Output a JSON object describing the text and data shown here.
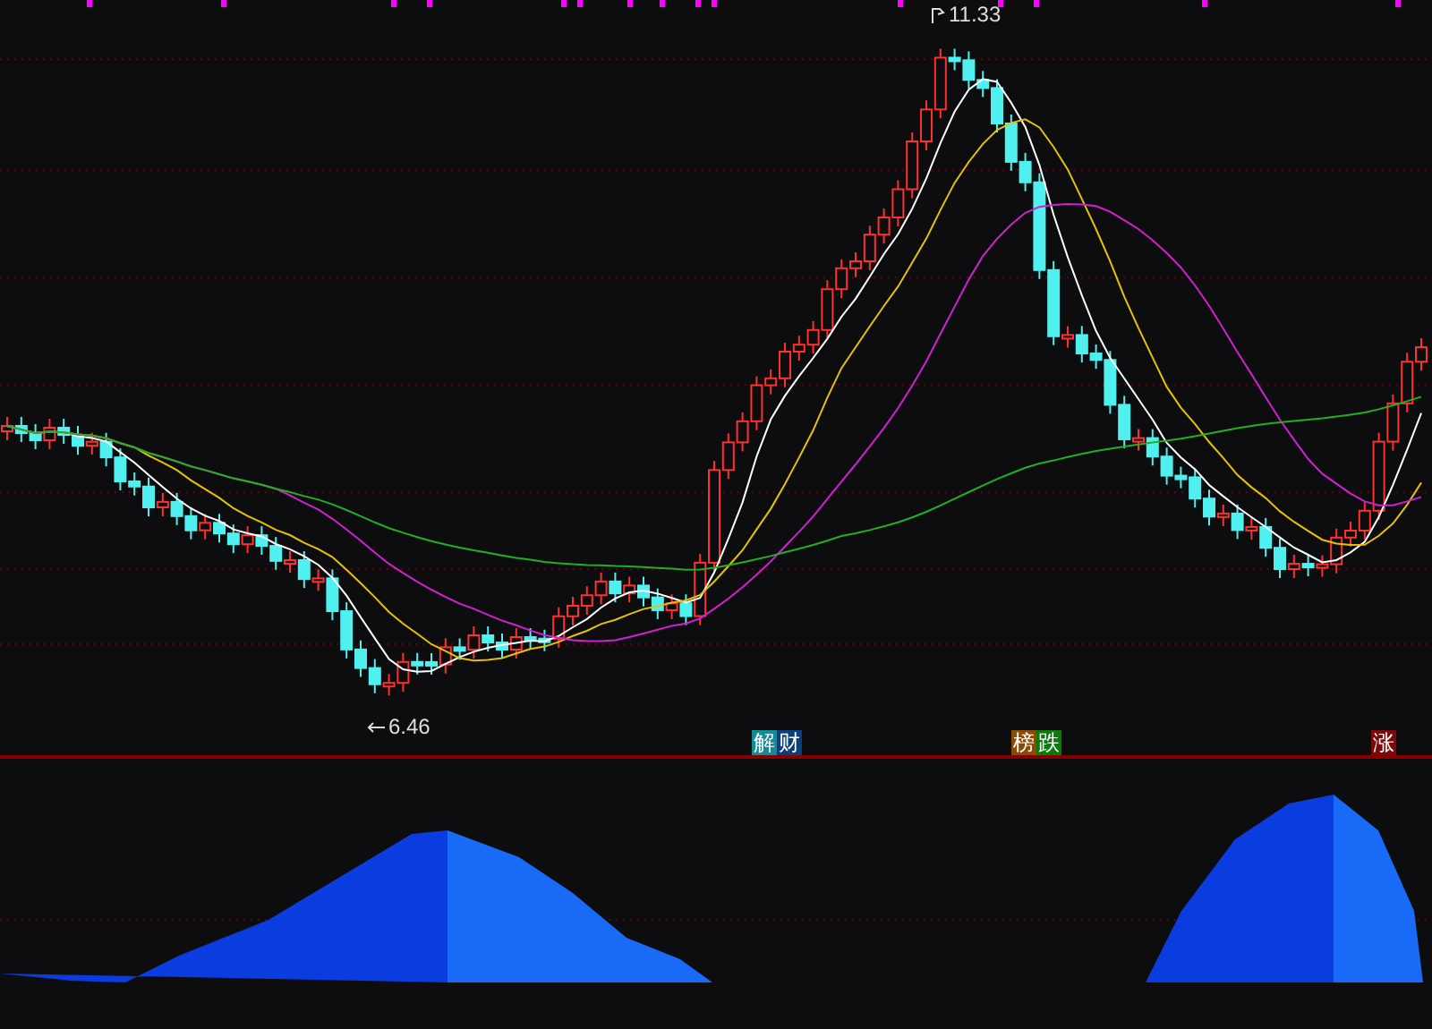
{
  "price_chart": {
    "high_label": "11.33",
    "low_label": "6.46"
  },
  "event_tag_groups": [
    {
      "tags": [
        {
          "text": "解",
          "color": "#138a94"
        },
        {
          "text": "财",
          "color": "#0b3f7a"
        }
      ]
    },
    {
      "tags": [
        {
          "text": "榜",
          "color": "#8a4a08"
        },
        {
          "text": "跌",
          "color": "#0a7a0a"
        }
      ]
    },
    {
      "tags": [
        {
          "text": "涨",
          "color": "#7a0a0a"
        }
      ]
    }
  ]
}
